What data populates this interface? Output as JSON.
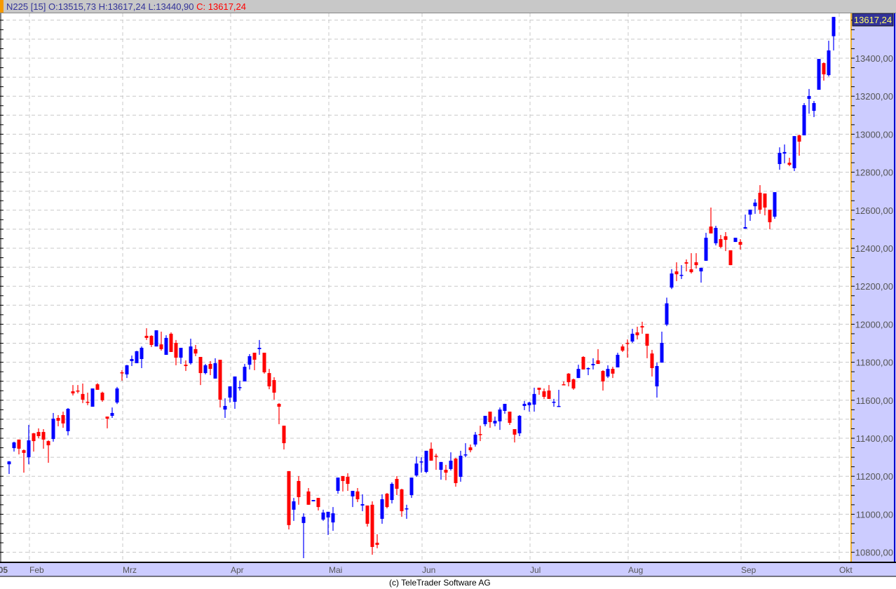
{
  "header": {
    "symbol": "N225",
    "period": "[15]",
    "open": "O:13515,73",
    "high": "H:13617,24",
    "low": "L:13440,90",
    "close_label": "C:",
    "close": "13617,24"
  },
  "last_price_label": "13617,24",
  "footer": "(c) TeleTrader Software AG",
  "colors": {
    "up": "#0000ff",
    "down": "#ff0000",
    "axis_bg": "#ccccff",
    "header_bg": "#c8c8c8",
    "last_label_bg": "#333399",
    "last_label_text": "#ffff66"
  },
  "chart_data": {
    "type": "candlestick",
    "ylim": [
      10750,
      13680
    ],
    "y_ticks": [
      "10800,00",
      "11000,00",
      "11200,00",
      "11400,00",
      "11600,00",
      "11800,00",
      "12000,00",
      "12200,00",
      "12400,00",
      "12600,00",
      "12800,00",
      "13000,00",
      "13200,00",
      "13400,00"
    ],
    "x_labels": [
      "'05",
      "Feb",
      "Mrz",
      "Apr",
      "Mai",
      "Jun",
      "Jul",
      "Aug",
      "Sep",
      "Okt"
    ],
    "x_label_candle_index": [
      -1.3,
      5,
      24,
      46,
      66,
      85,
      107,
      127,
      150,
      170
    ],
    "ohlc": [
      [
        11263,
        11280,
        11212,
        11278
      ],
      [
        11348,
        11382,
        11330,
        11378
      ],
      [
        11393,
        11393,
        11315,
        11345
      ],
      [
        11337,
        11341,
        11219,
        11323
      ],
      [
        11300,
        11470,
        11263,
        11389
      ],
      [
        11426,
        11428,
        11330,
        11385
      ],
      [
        11433,
        11452,
        11400,
        11411
      ],
      [
        11433,
        11448,
        11345,
        11393
      ],
      [
        11385,
        11389,
        11271,
        11363
      ],
      [
        11396,
        11533,
        11382,
        11503
      ],
      [
        11507,
        11522,
        11463,
        11492
      ],
      [
        11522,
        11540,
        11455,
        11478
      ],
      [
        11437,
        11559,
        11415,
        11555
      ],
      [
        11647,
        11680,
        11625,
        11636
      ],
      [
        11651,
        11680,
        11636,
        11647
      ],
      [
        11633,
        11688,
        11585,
        11603
      ],
      [
        11592,
        11640,
        11574,
        11588
      ],
      [
        11566,
        11662,
        11566,
        11662
      ],
      [
        11684,
        11690,
        11655,
        11655
      ],
      [
        11640,
        11645,
        11592,
        11600
      ],
      [
        11514,
        11514,
        11452,
        11503
      ],
      [
        11518,
        11562,
        11507,
        11533
      ],
      [
        11588,
        11670,
        11580,
        11662
      ],
      [
        11747,
        11758,
        11703,
        11743
      ],
      [
        11736,
        11786,
        11717,
        11784
      ],
      [
        11806,
        11835,
        11780,
        11817
      ],
      [
        11795,
        11860,
        11795,
        11858
      ],
      [
        11817,
        11883,
        11769,
        11876
      ],
      [
        11939,
        11979,
        11917,
        11928
      ],
      [
        11939,
        11942,
        11880,
        11891
      ],
      [
        11883,
        11968,
        11883,
        11968
      ],
      [
        11894,
        11961,
        11861,
        11869
      ],
      [
        11839,
        11942,
        11839,
        11928
      ],
      [
        11950,
        11957,
        11854,
        11854
      ],
      [
        11902,
        11917,
        11784,
        11824
      ],
      [
        11824,
        11876,
        11791,
        11876
      ],
      [
        11787,
        11810,
        11754,
        11780
      ],
      [
        11795,
        11924,
        11788,
        11883
      ],
      [
        11869,
        11891,
        11832,
        11846
      ],
      [
        11828,
        11828,
        11680,
        11743
      ],
      [
        11743,
        11791,
        11736,
        11784
      ],
      [
        11791,
        11806,
        11732,
        11765
      ],
      [
        11714,
        11821,
        11714,
        11795
      ],
      [
        11813,
        11813,
        11562,
        11603
      ],
      [
        11551,
        11610,
        11507,
        11570
      ],
      [
        11614,
        11673,
        11588,
        11673
      ],
      [
        11592,
        11725,
        11555,
        11725
      ],
      [
        11666,
        11703,
        11651,
        11669
      ],
      [
        11699,
        11791,
        11699,
        11776
      ],
      [
        11787,
        11843,
        11762,
        11832
      ],
      [
        11850,
        11850,
        11758,
        11813
      ],
      [
        11869,
        11917,
        11839,
        11876
      ],
      [
        11850,
        11850,
        11740,
        11747
      ],
      [
        11743,
        11765,
        11658,
        11673
      ],
      [
        11706,
        11721,
        11603,
        11640
      ],
      [
        11581,
        11585,
        11474,
        11566
      ],
      [
        11466,
        11466,
        11341,
        11374
      ],
      [
        11227,
        11227,
        10920,
        10943
      ],
      [
        11024,
        11086,
        10965,
        11068
      ],
      [
        11175,
        11201,
        11050,
        11090
      ],
      [
        10954,
        11005,
        10769,
        10987
      ],
      [
        11120,
        11138,
        11050,
        11050
      ],
      [
        11068,
        11075,
        11068,
        11075
      ],
      [
        11086,
        11086,
        11020,
        11038
      ],
      [
        10972,
        11024,
        10965,
        11009
      ],
      [
        10983,
        11013,
        10891,
        11013
      ],
      [
        10957,
        11038,
        10913,
        11005
      ],
      [
        11123,
        11193,
        11108,
        11193
      ],
      [
        11201,
        11201,
        11120,
        11175
      ],
      [
        11197,
        11216,
        11123,
        11160
      ],
      [
        11094,
        11123,
        11038,
        11123
      ],
      [
        11120,
        11138,
        11064,
        11079
      ],
      [
        11046,
        11105,
        11016,
        11053
      ],
      [
        11046,
        11046,
        10935,
        10950
      ],
      [
        11050,
        11068,
        10787,
        10828
      ],
      [
        10850,
        10895,
        10821,
        10839
      ],
      [
        10976,
        11105,
        10950,
        11079
      ],
      [
        11108,
        11112,
        11031,
        11038
      ],
      [
        11075,
        11168,
        11057,
        11160
      ],
      [
        11186,
        11201,
        11101,
        11134
      ],
      [
        11131,
        11134,
        10987,
        11016
      ],
      [
        11028,
        11050,
        10976,
        11031
      ],
      [
        11101,
        11193,
        11086,
        11193
      ],
      [
        11204,
        11304,
        11197,
        11267
      ],
      [
        11275,
        11300,
        11219,
        11278
      ],
      [
        11223,
        11334,
        11216,
        11334
      ],
      [
        11345,
        11378,
        11282,
        11282
      ],
      [
        11308,
        11319,
        11234,
        11304
      ],
      [
        11234,
        11275,
        11182,
        11275
      ],
      [
        11234,
        11260,
        11179,
        11219
      ],
      [
        11238,
        11326,
        11230,
        11282
      ],
      [
        11293,
        11297,
        11145,
        11164
      ],
      [
        11197,
        11334,
        11171,
        11308
      ],
      [
        11312,
        11374,
        11300,
        11315
      ],
      [
        11352,
        11367,
        11326,
        11337
      ],
      [
        11367,
        11433,
        11356,
        11419
      ],
      [
        11422,
        11466,
        11385,
        11419
      ],
      [
        11474,
        11518,
        11463,
        11518
      ],
      [
        11540,
        11540,
        11455,
        11485
      ],
      [
        11478,
        11514,
        11463,
        11492
      ],
      [
        11489,
        11562,
        11444,
        11551
      ],
      [
        11544,
        11581,
        11529,
        11581
      ],
      [
        11540,
        11540,
        11470,
        11481
      ],
      [
        11448,
        11448,
        11378,
        11419
      ],
      [
        11426,
        11522,
        11411,
        11518
      ],
      [
        11570,
        11596,
        11548,
        11581
      ],
      [
        11574,
        11592,
        11540,
        11588
      ],
      [
        11577,
        11666,
        11540,
        11633
      ],
      [
        11666,
        11666,
        11629,
        11655
      ],
      [
        11647,
        11662,
        11607,
        11618
      ],
      [
        11651,
        11680,
        11607,
        11607
      ],
      [
        11588,
        11607,
        11566,
        11592
      ],
      [
        11566,
        11655,
        11566,
        11570
      ],
      [
        11684,
        11699,
        11680,
        11680
      ],
      [
        11740,
        11743,
        11673,
        11695
      ],
      [
        11710,
        11714,
        11655,
        11662
      ],
      [
        11717,
        11787,
        11717,
        11765
      ],
      [
        11828,
        11832,
        11762,
        11762
      ],
      [
        11765,
        11773,
        11732,
        11769
      ],
      [
        11784,
        11821,
        11762,
        11791
      ],
      [
        11810,
        11869,
        11791,
        11791
      ],
      [
        11754,
        11758,
        11651,
        11699
      ],
      [
        11725,
        11784,
        11717,
        11765
      ],
      [
        11765,
        11776,
        11717,
        11740
      ],
      [
        11773,
        11850,
        11773,
        11839
      ],
      [
        11883,
        11894,
        11854,
        11861
      ],
      [
        11902,
        11920,
        11824,
        11898
      ],
      [
        11909,
        11976,
        11902,
        11950
      ],
      [
        11957,
        11987,
        11920,
        11942
      ],
      [
        11990,
        12013,
        11950,
        11983
      ],
      [
        11950,
        11950,
        11821,
        11887
      ],
      [
        11846,
        11865,
        11725,
        11769
      ],
      [
        11673,
        11798,
        11614,
        11780
      ],
      [
        11798,
        11961,
        11798,
        11902
      ],
      [
        11998,
        12140,
        11990,
        12110
      ],
      [
        12193,
        12290,
        12185,
        12267
      ],
      [
        12278,
        12326,
        12227,
        12263
      ],
      [
        12256,
        12311,
        12238,
        12260
      ],
      [
        12326,
        12341,
        12278,
        12319
      ],
      [
        12289,
        12374,
        12267,
        12274
      ],
      [
        12326,
        12374,
        12293,
        12311
      ],
      [
        12278,
        12297,
        12219,
        12297
      ],
      [
        12334,
        12481,
        12334,
        12455
      ],
      [
        12514,
        12614,
        12478,
        12478
      ],
      [
        12426,
        12518,
        12415,
        12507
      ],
      [
        12448,
        12470,
        12400,
        12407
      ],
      [
        12463,
        12485,
        12385,
        12444
      ],
      [
        12389,
        12389,
        12311,
        12311
      ],
      [
        12433,
        12455,
        12433,
        12455
      ],
      [
        12433,
        12448,
        12393,
        12418
      ],
      [
        12503,
        12577,
        12503,
        12511
      ],
      [
        12577,
        12603,
        12544,
        12603
      ],
      [
        12621,
        12658,
        12581,
        12640
      ],
      [
        12692,
        12732,
        12581,
        12603
      ],
      [
        12688,
        12688,
        12573,
        12614
      ],
      [
        12603,
        12603,
        12500,
        12537
      ],
      [
        12566,
        12695,
        12555,
        12695
      ],
      [
        12843,
        12931,
        12813,
        12902
      ],
      [
        12898,
        12946,
        12847,
        12906
      ],
      [
        12850,
        12876,
        12832,
        12839
      ],
      [
        12821,
        12990,
        12806,
        12990
      ],
      [
        12994,
        12998,
        12887,
        12961
      ],
      [
        12994,
        13164,
        12994,
        13153
      ],
      [
        13186,
        13238,
        13108,
        13201
      ],
      [
        13123,
        13175,
        13090,
        13164
      ],
      [
        13234,
        13396,
        13234,
        13396
      ],
      [
        13374,
        13378,
        13282,
        13315
      ],
      [
        13311,
        13492,
        13304,
        13441
      ],
      [
        13515.73,
        13617.24,
        13440.9,
        13617.24
      ]
    ]
  }
}
